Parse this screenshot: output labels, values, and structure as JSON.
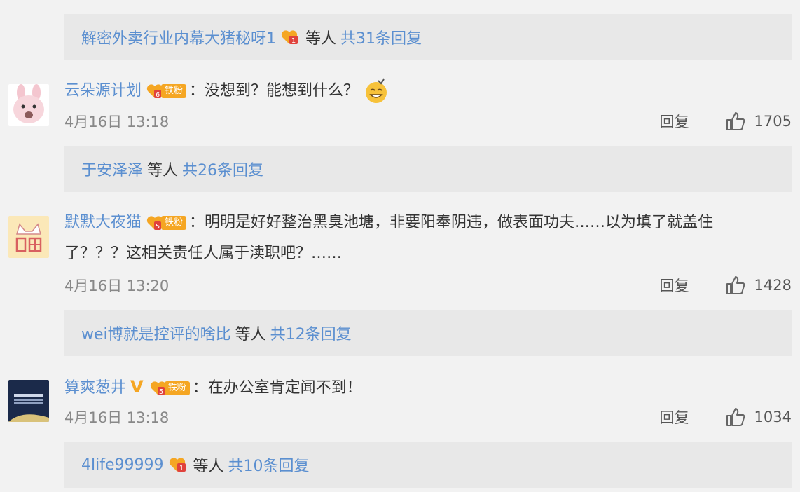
{
  "threads": [
    {
      "reply_bar": {
        "user": "解密外卖行业内幕大猪秘呀1",
        "has_badge": true,
        "suffix": "等人",
        "count_text": "共31条回复"
      }
    },
    {
      "comment": {
        "username": "云朵源计划",
        "badge_text": "铁粉",
        "badge_level": "6",
        "text": "：没想到？能想到什么？",
        "time": "4月16日 13:18",
        "reply_label": "回复",
        "likes": "1705"
      },
      "reply_bar": {
        "user": "于安泽泽",
        "has_badge": false,
        "suffix": "等人",
        "count_text": "共26条回复"
      }
    },
    {
      "comment": {
        "username": "默默大夜猫",
        "badge_text": "铁粉",
        "badge_level": "5",
        "text_line1": "：明明是好好整治黑臭池塘，非要阳奉阴违，做表面功夫……以为填了就盖住",
        "text_line2": "了？？？这相关责任人属于渎职吧？……",
        "time": "4月16日 13:20",
        "reply_label": "回复",
        "likes": "1428"
      },
      "reply_bar": {
        "user": "wei博就是控评的啥比",
        "has_badge": false,
        "suffix": "等人",
        "count_text": "共12条回复"
      }
    },
    {
      "comment": {
        "username": "算爽葱井",
        "verified": "V",
        "badge_text": "铁粉",
        "badge_level": "5",
        "text": "：在办公室肯定闻不到！",
        "time": "4月16日 13:18",
        "reply_label": "回复",
        "likes": "1034"
      },
      "reply_bar": {
        "user": "4life99999",
        "has_badge": true,
        "suffix": "等人",
        "count_text": "共10条回复"
      }
    }
  ],
  "colors": {
    "link": "#5b8fd0",
    "badge": "#f5a623",
    "meta": "#888888",
    "reply_bar_bg": "#e8e8e8",
    "page_bg": "#f2f2f2"
  }
}
